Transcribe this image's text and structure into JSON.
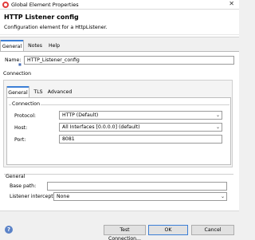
{
  "window": {
    "title": "Global Element Properties",
    "close_glyph": "✕"
  },
  "header": {
    "title": "HTTP Listener config",
    "description": "Configuration element for a HttpListener."
  },
  "main_tabs": [
    {
      "label": "General",
      "active": true
    },
    {
      "label": "Notes",
      "active": false
    },
    {
      "label": "Help",
      "active": false
    }
  ],
  "form": {
    "name_label": "Name:",
    "name_value": "HTTP_Listener_config",
    "connection_label": "Connection"
  },
  "connection_tabs": [
    {
      "label": "General",
      "active": true
    },
    {
      "label": "TLS",
      "active": false
    },
    {
      "label": "Advanced",
      "active": false
    }
  ],
  "connection": {
    "group_label": "Connection",
    "protocol_label": "Protocol:",
    "protocol_value": "HTTP (Default)",
    "host_label": "Host:",
    "host_value": "All Interfaces [0.0.0.0] (default)",
    "port_label": "Port:",
    "port_value": "8081"
  },
  "general": {
    "group_label": "General",
    "base_path_label": "Base path:",
    "base_path_value": "",
    "listener_label": "Listener interceptors",
    "listener_value": "None"
  },
  "footer": {
    "help_glyph": "?",
    "test_connection": "Test Connection...",
    "ok": "OK",
    "cancel": "Cancel"
  },
  "colors": {
    "accent": "#3c7fd6",
    "app_icon": "#e23b3b"
  }
}
